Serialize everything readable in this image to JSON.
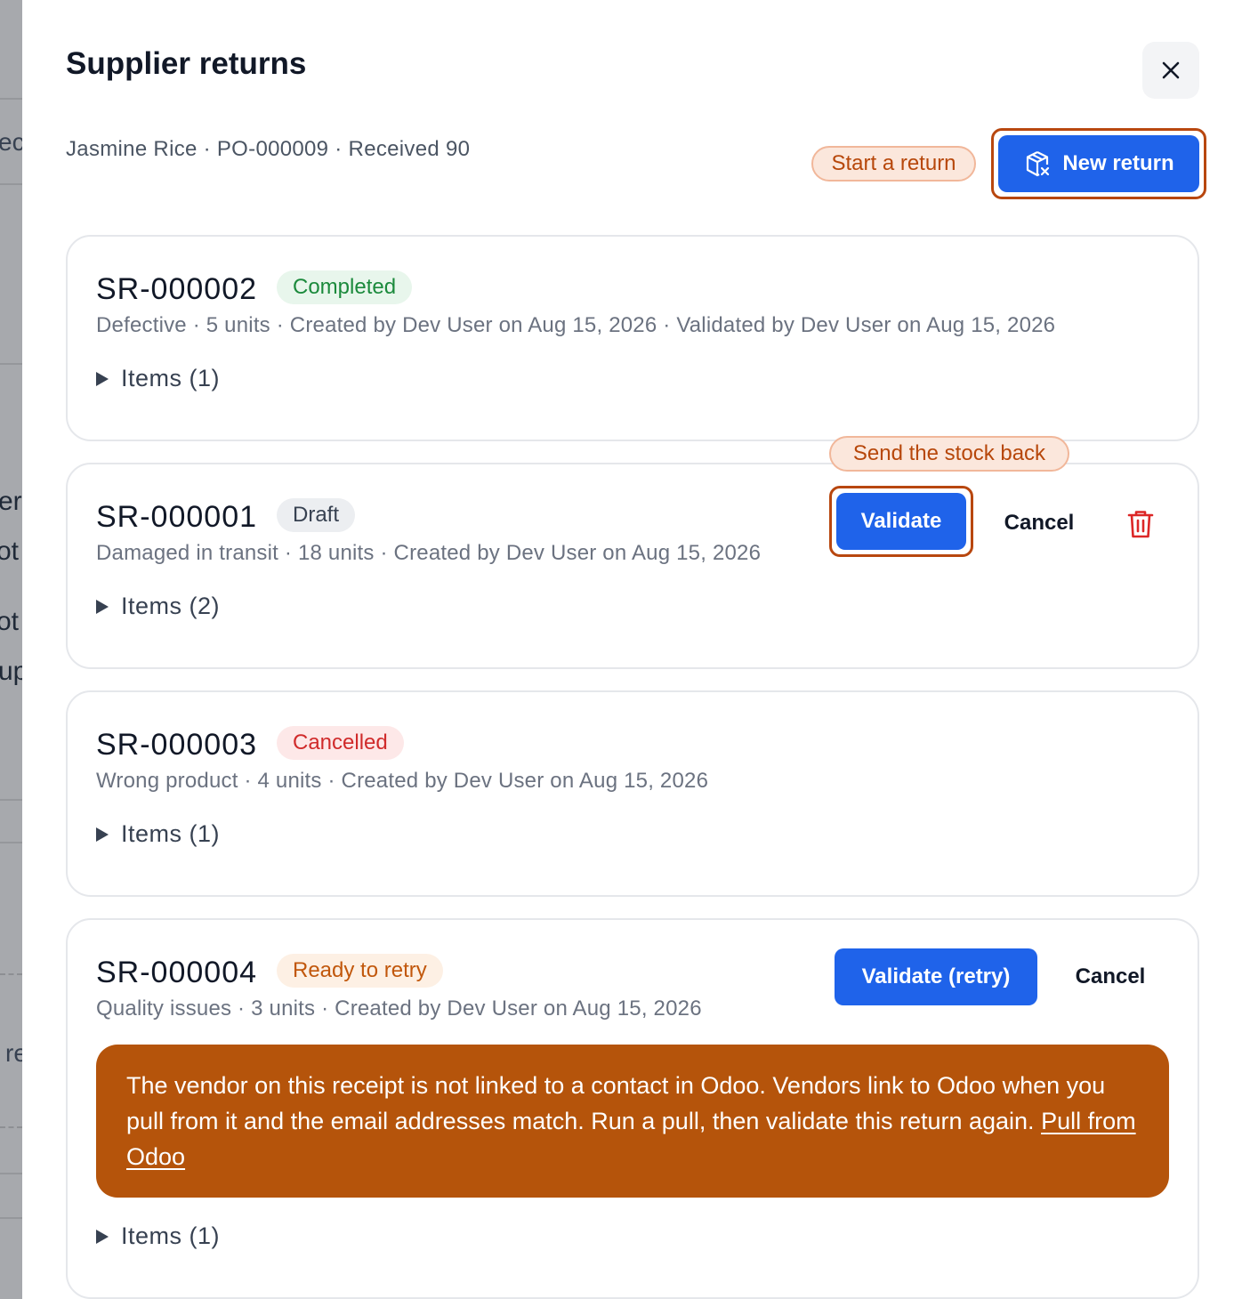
{
  "backdrop": {
    "fragments": [
      "ec",
      "er",
      "ot",
      "ot",
      "up",
      "re"
    ]
  },
  "dialog": {
    "title": "Supplier returns",
    "subtitle": "Jasmine Rice · PO-000009 · Received 90",
    "close_icon": "close-icon",
    "hint_start": "Start a return",
    "new_return_label": "New return",
    "new_return_icon": "package-x-icon"
  },
  "returns": [
    {
      "id": "SR-000002",
      "status": "Completed",
      "meta": "Defective · 5 units · Created by Dev User on Aug 15, 2026 · Validated by Dev User on Aug 15, 2026",
      "items_label": "Items (1)"
    },
    {
      "id": "SR-000001",
      "status": "Draft",
      "meta": "Damaged in transit · 18 units · Created by Dev User on Aug 15, 2026",
      "items_label": "Items (2)",
      "hint": "Send the stock back",
      "validate_label": "Validate",
      "cancel_label": "Cancel",
      "delete_icon": "trash-icon"
    },
    {
      "id": "SR-000003",
      "status": "Cancelled",
      "meta": "Wrong product · 4 units · Created by Dev User on Aug 15, 2026",
      "items_label": "Items (1)"
    },
    {
      "id": "SR-000004",
      "status": "Ready to retry",
      "meta": "Quality issues · 3 units · Created by Dev User on Aug 15, 2026",
      "items_label": "Items (1)",
      "validate_label": "Validate (retry)",
      "cancel_label": "Cancel",
      "alert_text": "The vendor on this receipt is not linked to a contact in Odoo. Vendors link to Odoo when you pull from it and the email addresses match. Run a pull, then validate this return again.",
      "alert_link": "Pull from Odoo"
    }
  ],
  "colors": {
    "primary": "#1f63ea",
    "highlight_ring": "#b8470f",
    "alert_bg": "#b5540b",
    "completed": "#1b8a3c",
    "cancelled": "#d02b2b",
    "retry": "#c1570b",
    "delete_icon": "#dc2626"
  }
}
